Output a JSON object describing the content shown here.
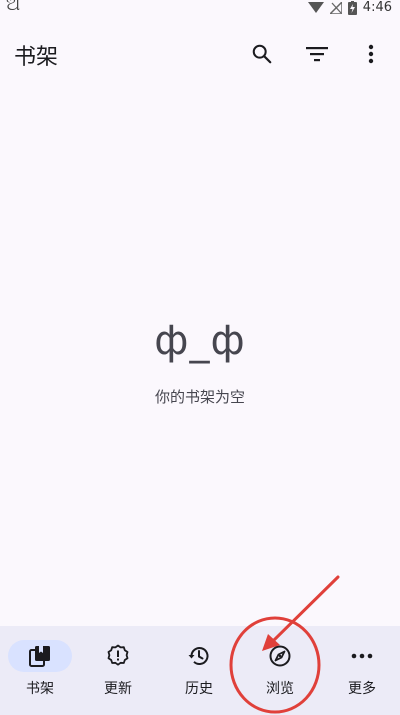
{
  "status_bar": {
    "time": "4:46",
    "icons": [
      "app-glyph-icon",
      "wifi-icon",
      "signal-icon",
      "battery-charging-icon"
    ]
  },
  "top_bar": {
    "title": "书架",
    "actions": [
      "search-icon",
      "filter-icon",
      "more-vert-icon"
    ]
  },
  "empty_state": {
    "face": "ф_ф",
    "message": "你的书架为空"
  },
  "bottom_nav": {
    "active_index": 0,
    "items": [
      {
        "label": "书架",
        "icon": "library-icon"
      },
      {
        "label": "更新",
        "icon": "updates-icon"
      },
      {
        "label": "历史",
        "icon": "history-icon"
      },
      {
        "label": "浏览",
        "icon": "explore-icon"
      },
      {
        "label": "更多",
        "icon": "more-horiz-icon"
      }
    ]
  },
  "annotation": {
    "color": "#e0403a"
  }
}
